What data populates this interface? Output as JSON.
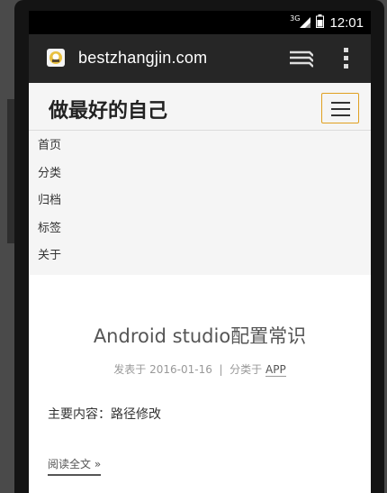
{
  "status_bar": {
    "network": "3G",
    "time": "12:01",
    "icons": [
      "signal-icon",
      "battery-icon"
    ]
  },
  "browser": {
    "url": "bestzhangjin.com",
    "icons": [
      "favicon",
      "tabs-icon",
      "overflow-menu-icon"
    ]
  },
  "site": {
    "title": "做最好的自己",
    "menu_icon": "hamburger-icon"
  },
  "nav": {
    "items": [
      "首页",
      "分类",
      "归档",
      "标签",
      "关于"
    ]
  },
  "post": {
    "title": "Android studio配置常识",
    "meta_prefix": "发表于 2016-01-16",
    "meta_separator": "|",
    "category_label": "分类于",
    "category": "APP",
    "excerpt": "主要内容：路径修改",
    "read_more": "阅读全文 »"
  }
}
